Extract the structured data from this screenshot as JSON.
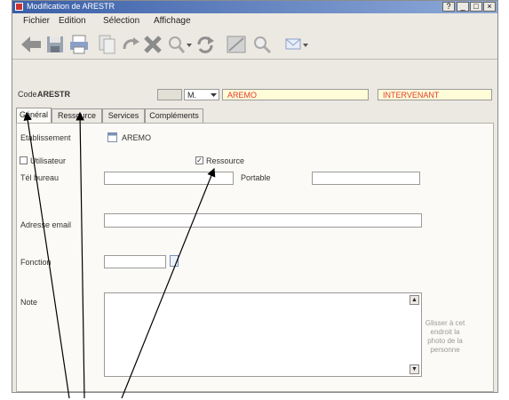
{
  "window": {
    "title": "Modification de ARESTR"
  },
  "menu": [
    "Fichier",
    "Edition",
    "Sélection",
    "Affichage"
  ],
  "header": {
    "code_label": "Code",
    "code_value": "ARESTR",
    "civility": "M.",
    "name_value": "AREMO",
    "role_value": "INTERVENANT"
  },
  "tabs": [
    "Général",
    "Ressource",
    "Services",
    "Compléments"
  ],
  "form": {
    "etablissement_label": "Etablissement",
    "etablissement_value": "AREMO",
    "utilisateur_label": "Utilisateur",
    "ressource_label": "Ressource",
    "tel_label": "Tél bureau",
    "portable_label": "Portable",
    "email_label": "Adresse email",
    "fonction_label": "Fonction",
    "note_label": "Note"
  },
  "photo_hint": "Glisser à cet endroit la photo de la personne",
  "checkbox_state": {
    "utilisateur": false,
    "ressource": true
  },
  "colors": {
    "titlebar": "#3a5fa8",
    "accent_red": "#e23b2a",
    "field_yellow": "#fffdd8"
  }
}
